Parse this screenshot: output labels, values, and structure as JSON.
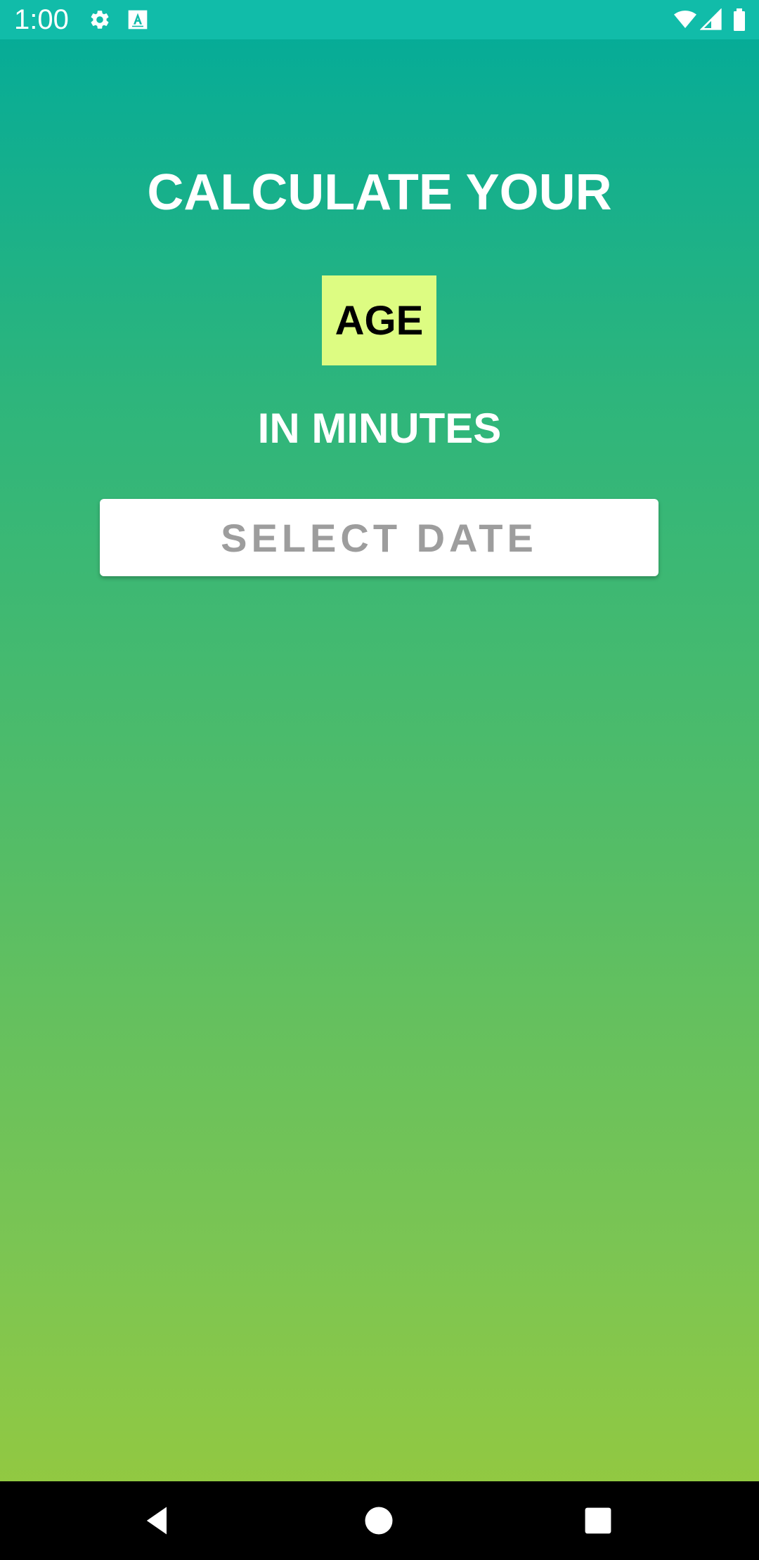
{
  "status_bar": {
    "time": "1:00",
    "icons": [
      "gear-icon",
      "accessibility-icon",
      "wifi-icon",
      "signal-icon",
      "battery-icon"
    ]
  },
  "main": {
    "headline_top": "CALCULATE YOUR",
    "highlight": "AGE",
    "headline_bottom": "IN MINUTES",
    "select_button_label": "SELECT DATE"
  },
  "navigation": {
    "icons": [
      "back-icon",
      "home-icon",
      "recents-icon"
    ]
  },
  "colors": {
    "status_bar": "#11bca9",
    "gradient_top": "#02ab9a",
    "gradient_bottom": "#99ca3c",
    "age_highlight": "#ddfc82",
    "button_text": "#9d9d9d"
  }
}
